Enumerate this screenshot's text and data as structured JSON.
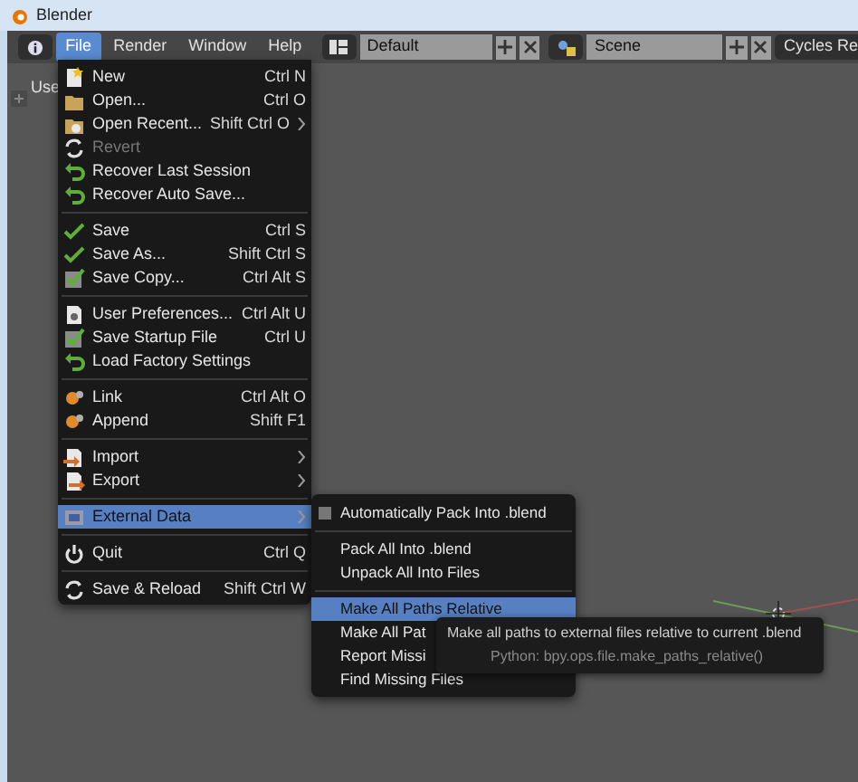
{
  "window": {
    "title": "Blender"
  },
  "header": {
    "menus": [
      {
        "label": "File",
        "selected": true
      },
      {
        "label": "Render",
        "selected": false
      },
      {
        "label": "Window",
        "selected": false
      },
      {
        "label": "Help",
        "selected": false
      }
    ],
    "screen_layout": "Default",
    "scene": "Scene",
    "render_engine": "Cycles Re"
  },
  "viewport": {
    "view_label": "Use"
  },
  "file_menu": {
    "sections": [
      {
        "items": [
          {
            "label": "New",
            "shortcut": "Ctrl N",
            "disabled": false,
            "selected": false,
            "submenu": false
          },
          {
            "label": "Open...",
            "shortcut": "Ctrl O",
            "disabled": false,
            "selected": false,
            "submenu": false
          },
          {
            "label": "Open Recent...",
            "shortcut": "Shift Ctrl O",
            "disabled": false,
            "selected": false,
            "submenu": true
          },
          {
            "label": "Revert",
            "disabled": true,
            "selected": false,
            "submenu": false
          },
          {
            "label": "Recover Last Session",
            "disabled": false,
            "selected": false,
            "submenu": false
          },
          {
            "label": "Recover Auto Save...",
            "disabled": false,
            "selected": false,
            "submenu": false
          }
        ]
      },
      {
        "items": [
          {
            "label": "Save",
            "shortcut": "Ctrl S",
            "disabled": false,
            "selected": false,
            "submenu": false
          },
          {
            "label": "Save As...",
            "shortcut": "Shift Ctrl S",
            "disabled": false,
            "selected": false,
            "submenu": false
          },
          {
            "label": "Save Copy...",
            "shortcut": "Ctrl Alt S",
            "disabled": false,
            "selected": false,
            "submenu": false
          }
        ]
      },
      {
        "items": [
          {
            "label": "User Preferences...",
            "shortcut": "Ctrl Alt U",
            "disabled": false,
            "selected": false,
            "submenu": false
          },
          {
            "label": "Save Startup File",
            "shortcut": "Ctrl U",
            "disabled": false,
            "selected": false,
            "submenu": false
          },
          {
            "label": "Load Factory Settings",
            "disabled": false,
            "selected": false,
            "submenu": false
          }
        ]
      },
      {
        "items": [
          {
            "label": "Link",
            "shortcut": "Ctrl Alt O",
            "disabled": false,
            "selected": false,
            "submenu": false
          },
          {
            "label": "Append",
            "shortcut": "Shift F1",
            "disabled": false,
            "selected": false,
            "submenu": false
          }
        ]
      },
      {
        "items": [
          {
            "label": "Import",
            "disabled": false,
            "selected": false,
            "submenu": true
          },
          {
            "label": "Export",
            "disabled": false,
            "selected": false,
            "submenu": true
          }
        ]
      },
      {
        "items": [
          {
            "label": "External Data",
            "disabled": false,
            "selected": true,
            "submenu": true
          }
        ]
      },
      {
        "items": [
          {
            "label": "Quit",
            "shortcut": "Ctrl Q",
            "disabled": false,
            "selected": false,
            "submenu": false
          }
        ]
      },
      {
        "items": [
          {
            "label": "Save & Reload",
            "shortcut": "Shift Ctrl W",
            "disabled": false,
            "selected": false,
            "submenu": false
          }
        ]
      }
    ]
  },
  "external_data_menu": {
    "sections": [
      {
        "items": [
          {
            "kind": "checkbox",
            "label": "Automatically Pack Into .blend",
            "checked": false,
            "selected": false
          }
        ]
      },
      {
        "items": [
          {
            "kind": "action",
            "label": "Pack All Into .blend",
            "selected": false
          },
          {
            "kind": "action",
            "label": "Unpack All Into Files",
            "selected": false
          }
        ]
      },
      {
        "items": [
          {
            "kind": "action",
            "label": "Make All Paths Relative",
            "selected": true
          },
          {
            "kind": "action",
            "label": "Make All Pat",
            "selected": false
          },
          {
            "kind": "action",
            "label": "Report Missi",
            "selected": false
          },
          {
            "kind": "action",
            "label": "Find Missing Files",
            "selected": false
          }
        ]
      }
    ]
  },
  "tooltip": {
    "description": "Make all paths to external files relative to current .blend",
    "python": "Python: bpy.ops.file.make_paths_relative()"
  }
}
